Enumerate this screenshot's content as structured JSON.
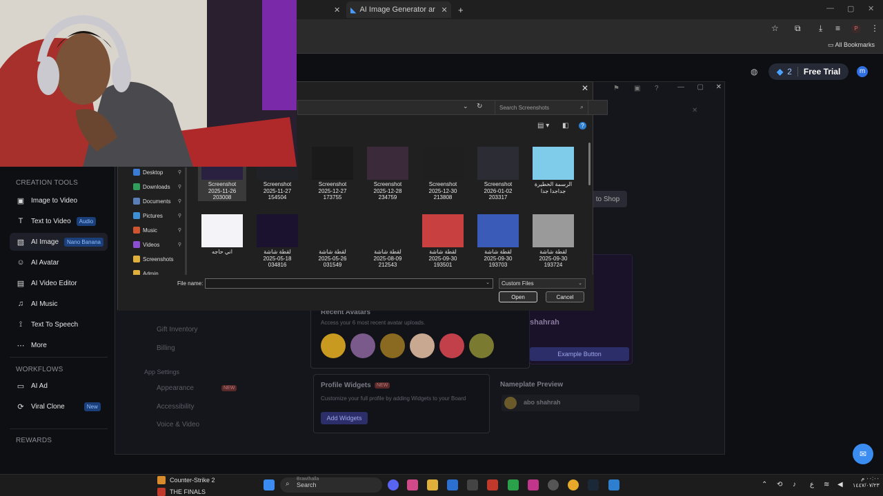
{
  "browser": {
    "tabs": [
      {
        "label": "AI Image Generator and Editor",
        "active": true
      }
    ],
    "new_tab": "+",
    "bookmarks_label": "All Bookmarks",
    "profile_initial": "P"
  },
  "header": {
    "credits": "2",
    "free_trial": "Free Trial",
    "user_initial": "m"
  },
  "sidebar": {
    "creation_title": "CREATION TOOLS",
    "items": [
      {
        "label": "Image to Video",
        "icon": "image-video-icon",
        "badge": ""
      },
      {
        "label": "Text to Video",
        "icon": "text-icon",
        "badge": "Audio"
      },
      {
        "label": "AI Image",
        "icon": "ai-image-icon",
        "badge": "Nano Banana",
        "active": true
      },
      {
        "label": "AI Avatar",
        "icon": "avatar-icon",
        "badge": ""
      },
      {
        "label": "AI Video Editor",
        "icon": "video-editor-icon",
        "badge": ""
      },
      {
        "label": "AI Music",
        "icon": "music-icon",
        "badge": ""
      },
      {
        "label": "Text To Speech",
        "icon": "speech-icon",
        "badge": ""
      },
      {
        "label": "More",
        "icon": "more-icon",
        "badge": ""
      }
    ],
    "workflows_title": "WORKFLOWS",
    "workflows": [
      {
        "label": "AI Ad",
        "icon": "ad-icon",
        "badge": ""
      },
      {
        "label": "Viral Clone",
        "icon": "clone-icon",
        "badge": "New"
      }
    ],
    "rewards_title": "REWARDS"
  },
  "background_app": {
    "shop_button": "to Shop",
    "recent_avatars_title": "Recent Avatars",
    "recent_avatars_desc": "Access your 6 most recent avatar uploads.",
    "username": "shahrah",
    "example_button": "Example Button",
    "profile_widgets_title": "Profile Widgets",
    "profile_widgets_badge": "NEW",
    "profile_widgets_desc": "Customize your full profile by adding Widgets to your Board",
    "add_widgets": "Add Widgets",
    "nameplate_title": "Nameplate Preview",
    "nameplate_name": "abo shahrah",
    "settings_items": [
      "Gift Inventory",
      "Billing",
      "App Settings",
      "Appearance",
      "Accessibility",
      "Voice & Video"
    ],
    "appearance_badge": "NEW"
  },
  "dialog": {
    "search_placeholder": "Search Screenshots",
    "nav_items": [
      {
        "label": "Desktop",
        "color": "#3a7bd5"
      },
      {
        "label": "Downloads",
        "color": "#2f9e5a"
      },
      {
        "label": "Documents",
        "color": "#5a7fb8"
      },
      {
        "label": "Pictures",
        "color": "#3d8fd6"
      },
      {
        "label": "Music",
        "color": "#d0542f"
      },
      {
        "label": "Videos",
        "color": "#8a4fd1"
      },
      {
        "label": "Screenshots",
        "color": "#e0b13a"
      },
      {
        "label": "Admin",
        "color": "#e0b13a"
      }
    ],
    "files_row1": [
      {
        "l1": "Screenshot",
        "l2": "2025-11-26",
        "l3": "203008",
        "thumb": "#2a2040"
      },
      {
        "l1": "Screenshot",
        "l2": "2025-11-27",
        "l3": "154504",
        "thumb": "#202228"
      },
      {
        "l1": "Screenshot",
        "l2": "2025-12-27",
        "l3": "173755",
        "thumb": "#1a1a1a"
      },
      {
        "l1": "Screenshot",
        "l2": "2025-12-28",
        "l3": "234759",
        "thumb": "#3a2a3a"
      },
      {
        "l1": "Screenshot",
        "l2": "2025-12-30",
        "l3": "213808",
        "thumb": "#1f1f1f"
      },
      {
        "l1": "Screenshot",
        "l2": "2026-01-02",
        "l3": "203317",
        "thumb": "#2c2c34"
      },
      {
        "l1": "الرسمة الخطيرة",
        "l2": "جداجدا جدا",
        "l3": "",
        "thumb": "#7ecbea"
      }
    ],
    "files_row2": [
      {
        "l1": "اني حاجه",
        "l2": "",
        "l3": "",
        "thumb": "#f4f4f8"
      },
      {
        "l1": "لقطة شاشة",
        "l2": "2025-05-18",
        "l3": "034816",
        "thumb": "#1b1230"
      },
      {
        "l1": "لقطة شاشة",
        "l2": "2025-05-26",
        "l3": "031549",
        "thumb": "#202020"
      },
      {
        "l1": "لقطة شاشة",
        "l2": "2025-08-09",
        "l3": "212543",
        "thumb": "#202020"
      },
      {
        "l1": "لقطة شاشة",
        "l2": "2025-09-30",
        "l3": "193501",
        "thumb": "#c94040"
      },
      {
        "l1": "لقطة شاشة",
        "l2": "2025-09-30",
        "l3": "193703",
        "thumb": "#3b5bb8"
      },
      {
        "l1": "لقطة شاشة",
        "l2": "2025-09-30",
        "l3": "193724",
        "thumb": "#9a9a9a"
      }
    ],
    "file_name_label": "File name:",
    "file_name_value": "",
    "file_type": "Custom Files",
    "open_button": "Open",
    "cancel_button": "Cancel"
  },
  "taskbar": {
    "apps": [
      {
        "label": "Counter-Strike 2",
        "color": "#d98c2b"
      },
      {
        "label": "THE FINALS",
        "color": "#c0392b"
      }
    ],
    "search_label": "Search",
    "search_hint": "Brawlhalla",
    "clock_time": "٠٠:٠٠ م",
    "clock_date": "١٤٤٧/٠٧/٢٣"
  }
}
